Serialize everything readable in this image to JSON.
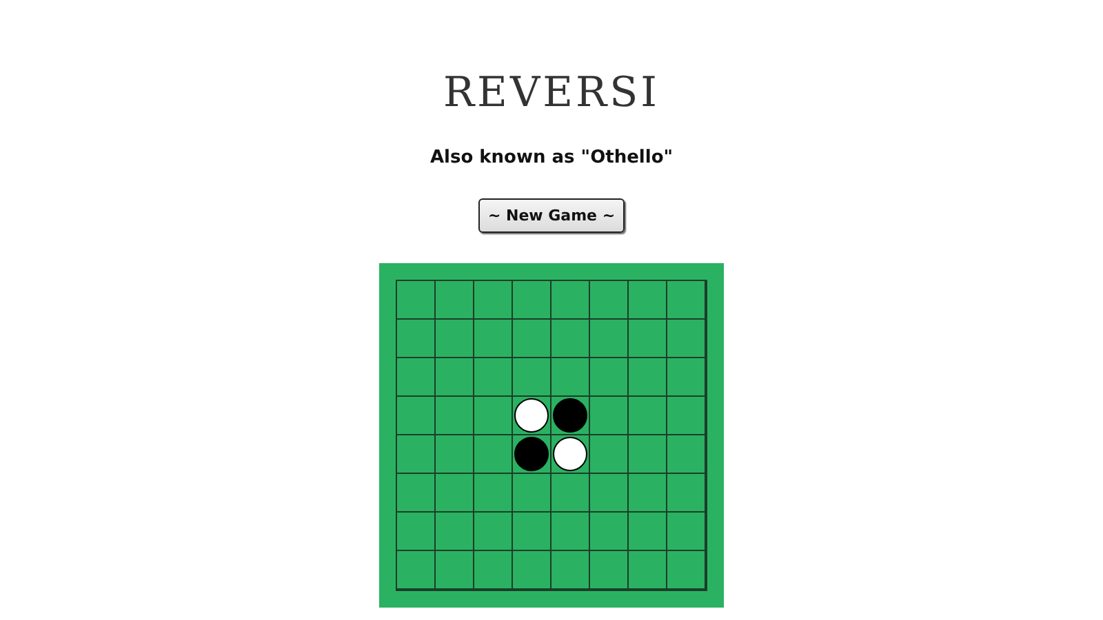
{
  "title": "REVERSI",
  "subtitle": "Also known as \"Othello\"",
  "new_game_button": "~ New Game ~",
  "board": {
    "rows": [
      [
        {
          "kind": "empty"
        },
        {
          "kind": "empty"
        },
        {
          "kind": "empty"
        },
        {
          "kind": "empty"
        },
        {
          "kind": "empty"
        },
        {
          "kind": "empty"
        },
        {
          "kind": "empty"
        },
        {
          "kind": "empty"
        }
      ],
      [
        {
          "kind": "empty"
        },
        {
          "kind": "empty"
        },
        {
          "kind": "empty"
        },
        {
          "kind": "empty"
        },
        {
          "kind": "empty"
        },
        {
          "kind": "empty"
        },
        {
          "kind": "empty"
        },
        {
          "kind": "empty"
        }
      ],
      [
        {
          "kind": "empty"
        },
        {
          "kind": "empty"
        },
        {
          "kind": "empty"
        },
        {
          "kind": "empty"
        },
        {
          "kind": "empty"
        },
        {
          "kind": "empty"
        },
        {
          "kind": "empty"
        },
        {
          "kind": "empty"
        }
      ],
      [
        {
          "kind": "empty"
        },
        {
          "kind": "empty"
        },
        {
          "kind": "empty"
        },
        {
          "kind": "white"
        },
        {
          "kind": "black"
        },
        {
          "kind": "empty"
        },
        {
          "kind": "empty"
        },
        {
          "kind": "empty"
        }
      ],
      [
        {
          "kind": "empty"
        },
        {
          "kind": "empty"
        },
        {
          "kind": "empty"
        },
        {
          "kind": "black"
        },
        {
          "kind": "white"
        },
        {
          "kind": "empty"
        },
        {
          "kind": "empty"
        },
        {
          "kind": "empty"
        }
      ],
      [
        {
          "kind": "empty"
        },
        {
          "kind": "empty"
        },
        {
          "kind": "empty"
        },
        {
          "kind": "empty"
        },
        {
          "kind": "empty"
        },
        {
          "kind": "empty"
        },
        {
          "kind": "empty"
        },
        {
          "kind": "empty"
        }
      ],
      [
        {
          "kind": "empty"
        },
        {
          "kind": "empty"
        },
        {
          "kind": "empty"
        },
        {
          "kind": "empty"
        },
        {
          "kind": "empty"
        },
        {
          "kind": "empty"
        },
        {
          "kind": "empty"
        },
        {
          "kind": "empty"
        }
      ],
      [
        {
          "kind": "empty"
        },
        {
          "kind": "empty"
        },
        {
          "kind": "empty"
        },
        {
          "kind": "empty"
        },
        {
          "kind": "empty"
        },
        {
          "kind": "empty"
        },
        {
          "kind": "empty"
        },
        {
          "kind": "empty"
        }
      ]
    ]
  }
}
